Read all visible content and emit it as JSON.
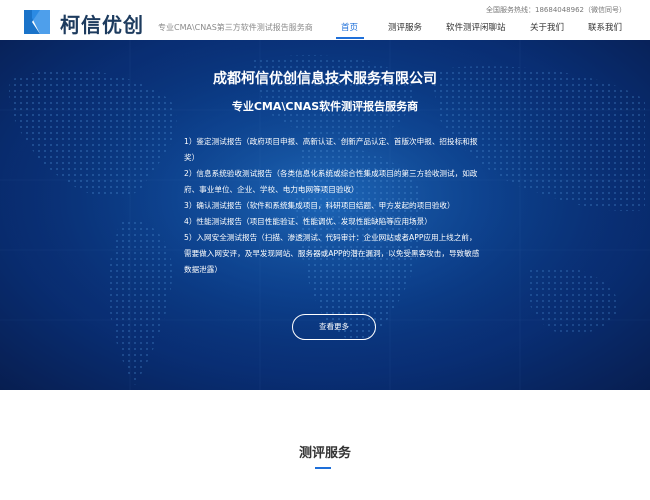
{
  "header": {
    "logo_text": "柯信优创",
    "slogan": "专业CMA\\CNAS第三方软件测试报告服务商",
    "hotline": "全国服务热线：18684048962（微信同号）",
    "nav": [
      {
        "label": "首页",
        "active": true
      },
      {
        "label": "测评服务",
        "active": false
      },
      {
        "label": "软件测评闲聊站",
        "active": false
      },
      {
        "label": "关于我们",
        "active": false
      },
      {
        "label": "联系我们",
        "active": false
      }
    ]
  },
  "hero": {
    "title": "成都柯信优创信息技术服务有限公司",
    "subtitle": "专业CMA\\CNAS软件测评报告服务商",
    "items": [
      "1）鉴定测试报告（政府项目申报、高新认证、创新产品认定、首版次申报、招投标和报奖）",
      "2）信息系统验收测试报告（各类信息化系统或综合性集成项目的第三方验收测试，如政府、事业单位、企业、学校、电力电网等项目验收）",
      "3）确认测试报告（软件和系统集成项目，科研项目结题、甲方发起的项目验收）",
      "4）性能测试报告（项目性能验证、性能调优、发现性能缺陷等应用场景）",
      "5）入网安全测试报告（扫描、渗透测试、代码审计：企业网站或者APP应用上线之前，需要做入网安评，及早发现网站、服务器或APP的潜在漏洞，以免受黑客攻击，导致敏感数据泄露）"
    ],
    "more_label": "查看更多"
  },
  "section": {
    "title": "测评服务"
  },
  "colors": {
    "accent": "#1e6fd9",
    "logo": "#1d3b5e",
    "hero_dark": "#071f55"
  }
}
